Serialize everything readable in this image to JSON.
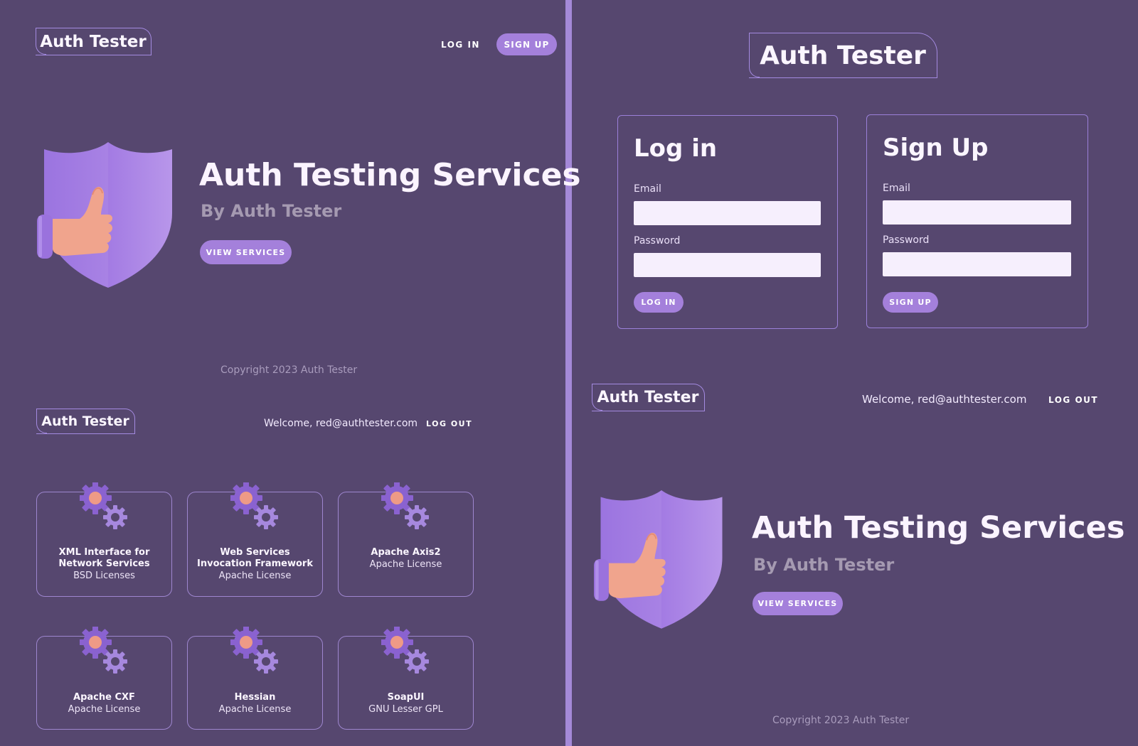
{
  "brand": "Auth Tester",
  "colors": {
    "background": "#56476f",
    "accent": "#a480db",
    "divider": "#a489d8",
    "border": "#a48ae0"
  },
  "panel_home": {
    "nav": {
      "login": "LOG IN",
      "signup": "SIGN UP"
    },
    "hero": {
      "title": "Auth Testing Services",
      "subtitle": "By Auth Tester",
      "button": "VIEW SERVICES"
    },
    "copyright": "Copyright 2023 Auth Tester"
  },
  "panel_services": {
    "welcome": "Welcome, red@authtester.com",
    "logout": "LOG OUT",
    "cards": [
      {
        "name": "XML Interface for Network Services",
        "license": "BSD Licenses"
      },
      {
        "name": "Web Services Invocation Framework",
        "license": "Apache License"
      },
      {
        "name": "Apache Axis2",
        "license": "Apache License"
      },
      {
        "name": "Apache CXF",
        "license": "Apache License"
      },
      {
        "name": "Hessian",
        "license": "Apache License"
      },
      {
        "name": "SoapUI",
        "license": "GNU Lesser GPL"
      }
    ]
  },
  "panel_auth": {
    "login": {
      "title": "Log in",
      "email_label": "Email",
      "password_label": "Password",
      "button": "LOG IN"
    },
    "signup": {
      "title": "Sign Up",
      "email_label": "Email",
      "password_label": "Password",
      "button": "SIGN UP"
    }
  },
  "panel_loggedin": {
    "welcome": "Welcome, red@authtester.com",
    "logout": "LOG OUT",
    "hero": {
      "title": "Auth Testing Services",
      "subtitle": "By Auth Tester",
      "button": "VIEW SERVICES"
    },
    "copyright": "Copyright 2023 Auth Tester"
  }
}
